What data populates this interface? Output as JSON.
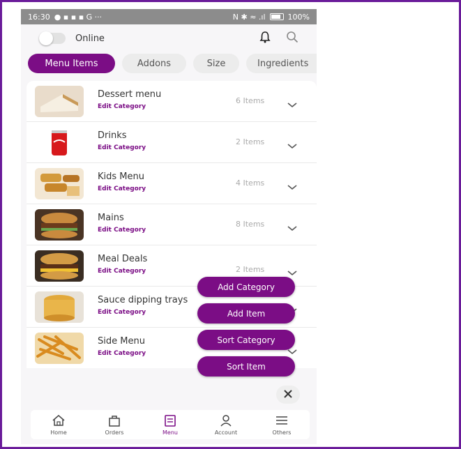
{
  "status_bar": {
    "time": "16:30",
    "battery": "100%"
  },
  "header": {
    "online_label": "Online",
    "online_on": false
  },
  "tabs": [
    {
      "label": "Menu Items",
      "active": true
    },
    {
      "label": "Addons",
      "active": false
    },
    {
      "label": "Size",
      "active": false
    },
    {
      "label": "Ingredients",
      "active": false
    }
  ],
  "categories": [
    {
      "name": "Dessert menu",
      "edit": "Edit Category",
      "count": "6 Items"
    },
    {
      "name": "Drinks",
      "edit": "Edit Category",
      "count": "2 Items"
    },
    {
      "name": "Kids Menu",
      "edit": "Edit Category",
      "count": "4 Items"
    },
    {
      "name": "Mains",
      "edit": "Edit Category",
      "count": "8 Items"
    },
    {
      "name": "Meal Deals",
      "edit": "Edit Category",
      "count": "2 Items"
    },
    {
      "name": "Sauce dipping trays",
      "edit": "Edit Category",
      "count": ""
    },
    {
      "name": "Side Menu",
      "edit": "Edit Category",
      "count": ""
    }
  ],
  "fab_menu": {
    "add_category": "Add Category",
    "add_item": "Add Item",
    "sort_category": "Sort Category",
    "sort_item": "Sort Item"
  },
  "bottom_nav": [
    {
      "label": "Home",
      "icon": "home-icon",
      "active": false
    },
    {
      "label": "Orders",
      "icon": "shopping-bag-icon",
      "active": false
    },
    {
      "label": "Menu",
      "icon": "menu-book-icon",
      "active": true
    },
    {
      "label": "Account",
      "icon": "user-icon",
      "active": false
    },
    {
      "label": "Others",
      "icon": "hamburger-icon",
      "active": false
    }
  ],
  "colors": {
    "accent": "#7b0d85",
    "frame": "#6a1b9a",
    "status_bar": "#8c8c8c"
  }
}
